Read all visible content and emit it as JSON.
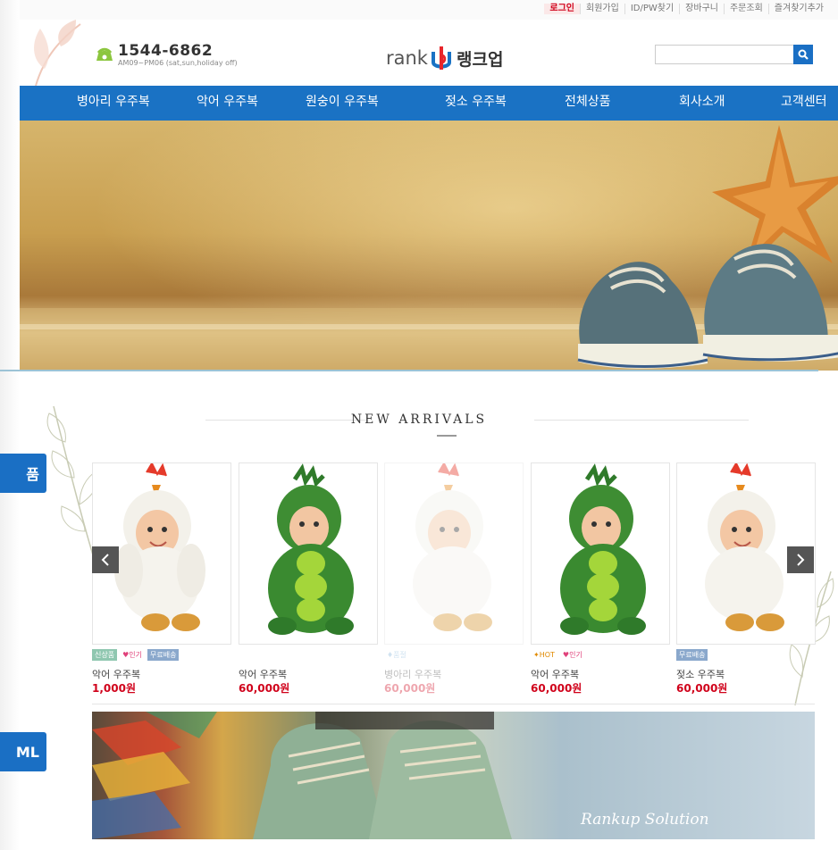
{
  "side_tabs": [
    "품",
    "ML"
  ],
  "top_links": [
    "로그인",
    "회원가입",
    "ID/PW찾기",
    "장바구니",
    "주문조회",
    "즐겨찾기추가"
  ],
  "header": {
    "phone": "1544-6862",
    "hours": "AM09~PM06 (sat,sun,holiday off)",
    "logo_en": "rank",
    "logo_kr": "랭크업",
    "search_placeholder": ""
  },
  "nav": [
    "병아리 우주복",
    "악어 우주복",
    "원숭이 우주복",
    "젖소 우주복",
    "전체상품",
    "회사소개",
    "고객센터"
  ],
  "section_title": "NEW ARRIVALS",
  "products": [
    {
      "badges": [
        "신상품",
        "인기",
        "무료배송"
      ],
      "name": "악어 우주복",
      "price": "1,000원",
      "costume": "chick",
      "faded": false
    },
    {
      "badges": [],
      "name": "악어 우주복",
      "price": "60,000원",
      "costume": "pea",
      "faded": false
    },
    {
      "badges": [
        "품절"
      ],
      "name": "병아리 우주복",
      "price": "60,000원",
      "costume": "chick",
      "faded": true
    },
    {
      "badges": [
        "HOT",
        "인기"
      ],
      "name": "악어 우주복",
      "price": "60,000원",
      "costume": "pea",
      "faded": false
    },
    {
      "badges": [
        "무료배송"
      ],
      "name": "젖소 우주복",
      "price": "60,000원",
      "costume": "chick",
      "faded": false
    }
  ],
  "banner_text": "Rankup Solution",
  "colors": {
    "nav": "#1a72c4",
    "price": "#d0021b",
    "login": "#d0021b"
  }
}
